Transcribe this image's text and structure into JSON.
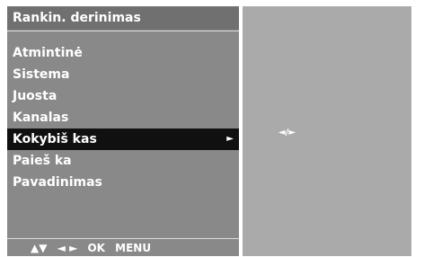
{
  "menu": {
    "title": "Rankin. derinimas",
    "items": [
      {
        "label": "Atmintinė"
      },
      {
        "label": "Sistema"
      },
      {
        "label": "Juosta"
      },
      {
        "label": "Kanalas"
      },
      {
        "label": "Kokybiš kas",
        "selected": true,
        "submenu_arrow": "►"
      },
      {
        "label": "Paieš ka"
      },
      {
        "label": "Pavadinimas"
      }
    ]
  },
  "footer": {
    "up_down": "▲▼",
    "left_right": "◄ ►",
    "ok": "OK",
    "menu": "MENU"
  },
  "right_panel": {
    "adjust_indicator": "◄/►"
  },
  "colors": {
    "menu_panel_bg": "#898989",
    "title_bar_bg": "#707070",
    "selected_row_bg": "#101010",
    "right_panel_bg": "#aaaaaa",
    "text": "#ffffff"
  }
}
